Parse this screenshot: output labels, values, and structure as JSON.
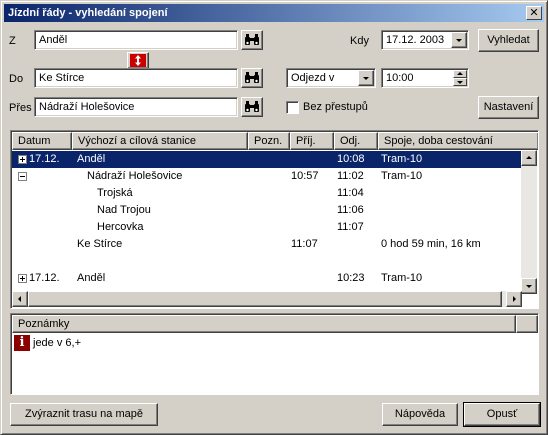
{
  "window": {
    "title": "Jízdní řády - vyhledání spojení",
    "close_glyph": "✕"
  },
  "form": {
    "from_label": "Z",
    "from_value": "Anděl",
    "to_label": "Do",
    "to_value": "Ke Stírce",
    "via_label": "Přes",
    "via_value": "Nádraží Holešovice",
    "when_label": "Kdy",
    "date_value": "17.12. 2003",
    "mode_value": "Odjezd v",
    "time_value": "10:00",
    "no_transfer_label": "Bez přestupů",
    "no_transfer_checked": false,
    "search_button": "Vyhledat",
    "settings_button": "Nastavení",
    "swap_icon": "swap-arrows-icon",
    "search_icon": "binoculars-icon"
  },
  "results": {
    "columns": [
      "Datum",
      "Výchozí a cílová stanice",
      "Pozn.",
      "Příj.",
      "Odj.",
      "Spoje, doba cestování"
    ],
    "rows": [
      {
        "tree": "plus",
        "date": "17.12.",
        "station": "Anděl",
        "note": "",
        "arr": "",
        "dep": "10:08",
        "info": "Tram-10",
        "selected": true,
        "indent": 0
      },
      {
        "tree": "minus",
        "date": "",
        "station": "Nádraží Holešovice",
        "note": "",
        "arr": "10:57",
        "dep": "11:02",
        "info": "Tram-10",
        "selected": false,
        "indent": 1
      },
      {
        "tree": "",
        "date": "",
        "station": "Trojská",
        "note": "",
        "arr": "",
        "dep": "11:04",
        "info": "",
        "selected": false,
        "indent": 2
      },
      {
        "tree": "",
        "date": "",
        "station": "Nad Trojou",
        "note": "",
        "arr": "",
        "dep": "11:06",
        "info": "",
        "selected": false,
        "indent": 2
      },
      {
        "tree": "",
        "date": "",
        "station": "Hercovka",
        "note": "",
        "arr": "",
        "dep": "11:07",
        "info": "",
        "selected": false,
        "indent": 2
      },
      {
        "tree": "",
        "date": "",
        "station": "Ke Stírce",
        "note": "",
        "arr": "11:07",
        "dep": "",
        "info": "0 hod 59 min, 16 km",
        "selected": false,
        "indent": 0
      },
      {
        "tree": "",
        "date": "",
        "station": "",
        "note": "",
        "arr": "",
        "dep": "",
        "info": "",
        "selected": false,
        "indent": 0
      },
      {
        "tree": "plus",
        "date": "17.12.",
        "station": "Anděl",
        "note": "",
        "arr": "",
        "dep": "10:23",
        "info": "Tram-10",
        "selected": false,
        "indent": 0
      }
    ]
  },
  "notes": {
    "header": "Poznámky",
    "icon": "info-icon",
    "icon_glyph": "i",
    "text": "jede v 6,+"
  },
  "footer": {
    "map_button": "Zvýraznit trasu na mapě",
    "help_button": "Nápověda",
    "close_button": "Opusť"
  },
  "colors": {
    "title_start": "#0a246a",
    "title_end": "#a6caf0",
    "selection": "#0a246a",
    "face": "#d4d0c8",
    "swap_red": "#cc0000",
    "info_red": "#8b0000"
  }
}
